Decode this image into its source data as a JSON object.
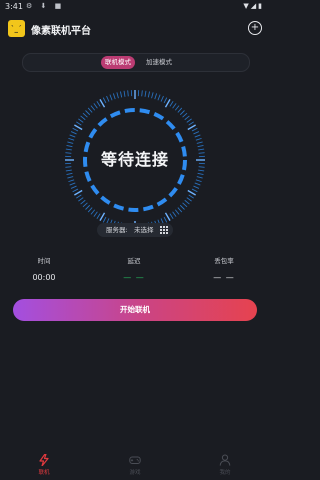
{
  "status_bar": {
    "time": "3:41",
    "left_icons": "⚙ ⬇ ■",
    "right_icons": "▼◢▮"
  },
  "header": {
    "title": "像素联机平台",
    "logo_face": "`_´",
    "add_symbol": "+"
  },
  "mode_switch": {
    "active_label": "联机模式",
    "inactive_label": "加速模式"
  },
  "gauge": {
    "status_text": "等待连接",
    "accent": "#2f8cf0"
  },
  "server": {
    "label": "服务器:",
    "value": "未选择"
  },
  "stats": [
    {
      "label": "时间",
      "value": "00:00"
    },
    {
      "label": "延迟",
      "value": "— —"
    },
    {
      "label": "丢包率",
      "value": "— —"
    }
  ],
  "start_button": {
    "label": "开始联机"
  },
  "bottom_nav": [
    {
      "label": "联机",
      "icon": "bolt-icon",
      "active": true
    },
    {
      "label": "游戏",
      "icon": "gamepad-icon",
      "active": false
    },
    {
      "label": "我的",
      "icon": "user-icon",
      "active": false
    }
  ],
  "colors": {
    "background": "#1a1c22",
    "accent_pink": "#bb3c73",
    "gradient_start": "#a34fe0",
    "gradient_end": "#e6434f",
    "active_nav": "#e0393e",
    "latency_green": "#25c060"
  }
}
